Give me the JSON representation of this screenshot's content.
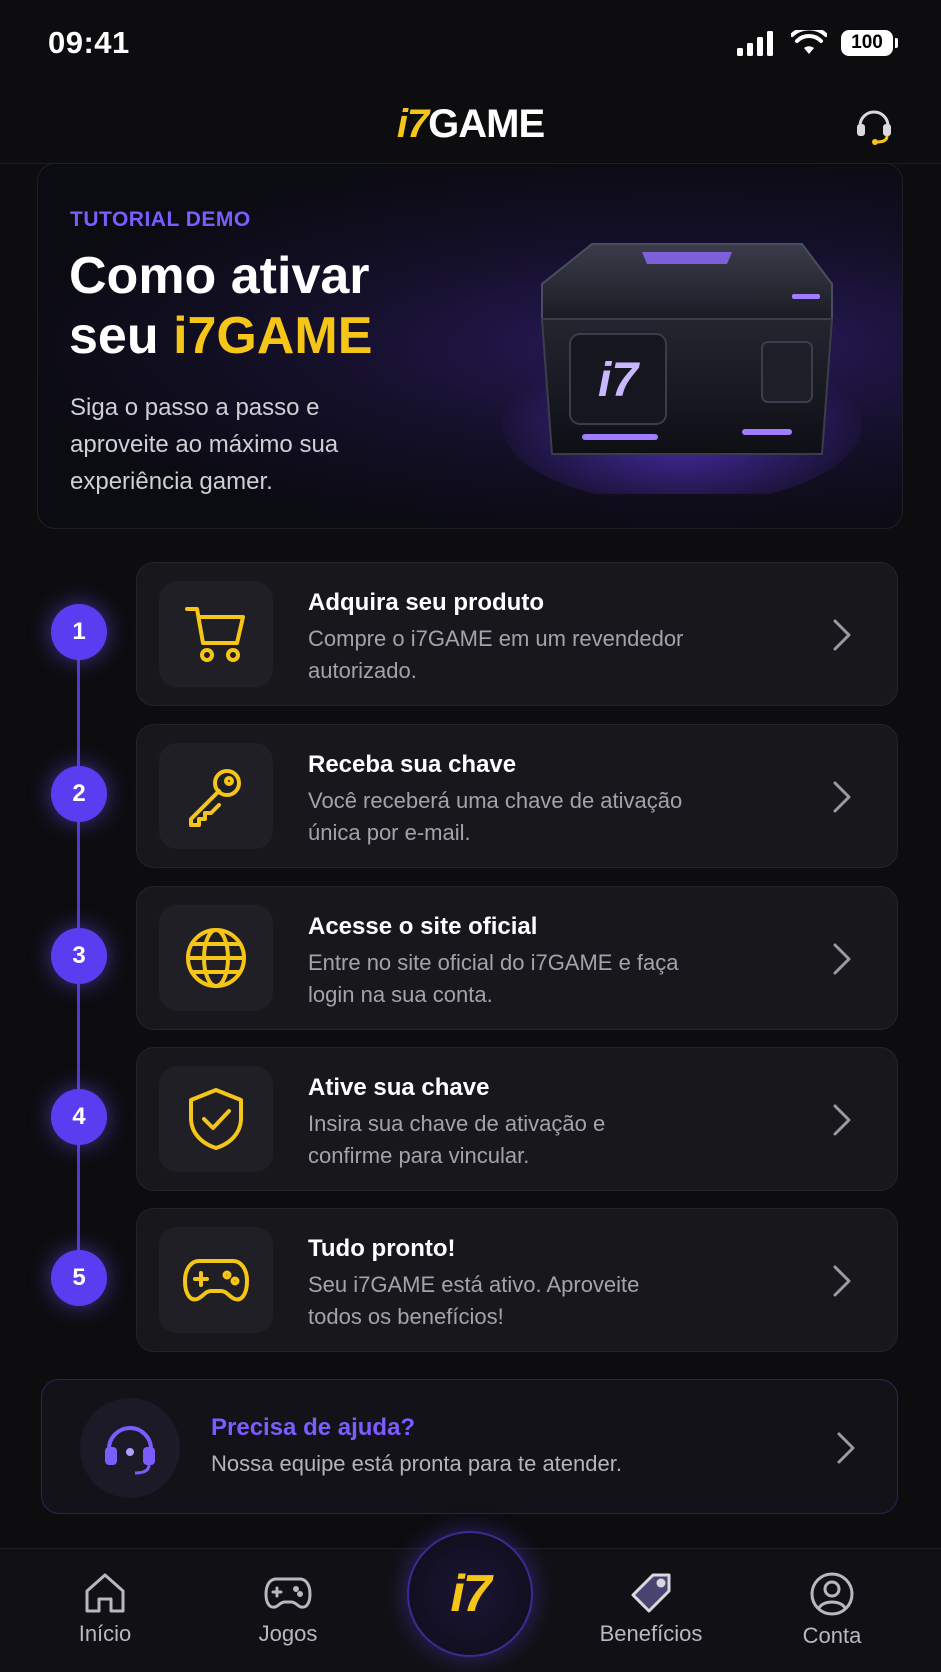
{
  "status_bar": {
    "time": "09:41",
    "battery": "100"
  },
  "header": {
    "logo_i7": "i7",
    "logo_game": "GAME"
  },
  "hero": {
    "tag": "TUTORIAL DEMO",
    "title_line1": "Como ativar",
    "title_line2_prefix": "seu ",
    "title_line2_accent": "i7GAME",
    "desc": "Siga o passo a passo e aproveite ao máximo sua experiência gamer.",
    "chest_label": "i7"
  },
  "steps": [
    {
      "num": "1",
      "icon": "cart-icon",
      "title": "Adquira seu produto",
      "desc": "Compre o i7GAME em um revendedor autorizado."
    },
    {
      "num": "2",
      "icon": "key-icon",
      "title": "Receba sua chave",
      "desc": "Você receberá uma chave de ativação única por e-mail."
    },
    {
      "num": "3",
      "icon": "globe-icon",
      "title": "Acesse o site oficial",
      "desc": "Entre no site oficial do i7GAME e faça login na sua conta."
    },
    {
      "num": "4",
      "icon": "shield-check-icon",
      "title": "Ative sua chave",
      "desc": "Insira sua chave de ativação e confirme para vincular."
    },
    {
      "num": "5",
      "icon": "gamepad-icon",
      "title": "Tudo pronto!",
      "desc": "Seu i7GAME está ativo. Aproveite todos os benefícios!"
    }
  ],
  "help": {
    "title": "Precisa de ajuda?",
    "desc": "Nossa equipe está pronta para te atender."
  },
  "nav": {
    "inicio": "Início",
    "jogos": "Jogos",
    "center": "i7",
    "beneficios": "Benefícios",
    "conta": "Conta"
  },
  "colors": {
    "accent_yellow": "#f5c518",
    "accent_purple": "#5a3df0",
    "background": "#0d0d10"
  }
}
